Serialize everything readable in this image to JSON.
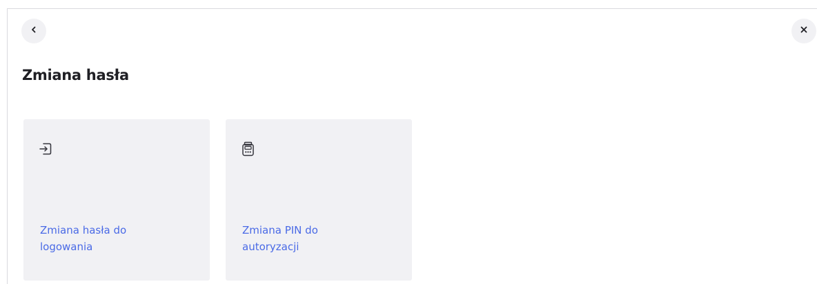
{
  "header": {
    "back_icon": "chevron-left-icon",
    "close_icon": "close-icon",
    "title": "Zmiana hasła"
  },
  "tiles": [
    {
      "icon": "login-arrow-icon",
      "label_line1": "Zmiana hasła do",
      "label_line2": "logowania"
    },
    {
      "icon": "token-device-icon",
      "label_line1": "Zmiana PIN do",
      "label_line2": "autoryzacji"
    }
  ],
  "colors": {
    "accent": "#4a6ae6",
    "tile_background": "#f1f1f4",
    "title_text": "#1f1f24"
  }
}
